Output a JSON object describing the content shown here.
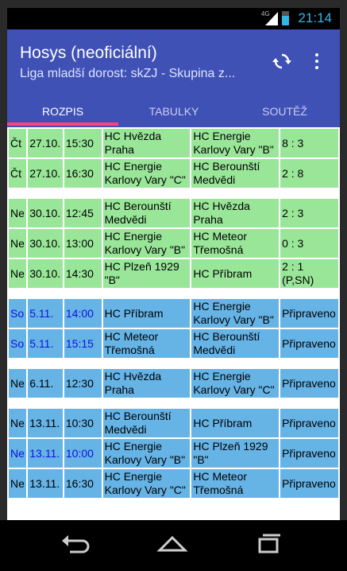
{
  "status_bar": {
    "time": "21:14",
    "network": "4G"
  },
  "app_bar": {
    "title": "Hosys (neoficiální)",
    "subtitle": "Liga mladší dorost: skZJ - Skupina z..."
  },
  "tabs": [
    {
      "label": "ROZPIS",
      "active": true
    },
    {
      "label": "TABULKY",
      "active": false
    },
    {
      "label": "SOUTĚŽ",
      "active": false
    }
  ],
  "colors": {
    "app_bar": "#3f51b5",
    "tab_indicator": "#ff4081",
    "played_row": "#99e699",
    "upcoming_row": "#66b3e6",
    "weekend_text": "#1010e0"
  },
  "schedule": {
    "groups": [
      {
        "color": "green",
        "rows": [
          {
            "day": "Čt",
            "date": "27.10.",
            "time": "15:30",
            "home": "HC Hvězda Praha",
            "away": "HC Energie Karlovy Vary \"B\"",
            "result": "8 : 3",
            "highlight": false
          },
          {
            "day": "Čt",
            "date": "27.10.",
            "time": "16:30",
            "home": "HC Energie Karlovy Vary \"C\"",
            "away": "HC Berounští Medvědi",
            "result": "2 : 8",
            "highlight": false
          }
        ]
      },
      {
        "color": "green",
        "rows": [
          {
            "day": "Ne",
            "date": "30.10.",
            "time": "12:45",
            "home": "HC Berounští Medvědi",
            "away": "HC Hvězda Praha",
            "result": "2 : 3",
            "highlight": false
          },
          {
            "day": "Ne",
            "date": "30.10.",
            "time": "13:00",
            "home": "HC Energie Karlovy Vary \"B\"",
            "away": "HC Meteor Třemošná",
            "result": "0 : 3",
            "highlight": false
          },
          {
            "day": "Ne",
            "date": "30.10.",
            "time": "14:30",
            "home": "HC Plzeň 1929 \"B\"",
            "away": "HC Příbram",
            "result": "2 : 1 (P,SN)",
            "highlight": false
          }
        ]
      },
      {
        "color": "blue",
        "rows": [
          {
            "day": "So",
            "date": "5.11.",
            "time": "14:00",
            "home": "HC Příbram",
            "away": "HC Energie Karlovy Vary \"B\"",
            "result": "Připraveno",
            "highlight": true
          },
          {
            "day": "So",
            "date": "5.11.",
            "time": "15:15",
            "home": "HC Meteor Třemošná",
            "away": "HC Berounští Medvědi",
            "result": "Připraveno",
            "highlight": true
          }
        ]
      },
      {
        "color": "blue",
        "rows": [
          {
            "day": "Ne",
            "date": "6.11.",
            "time": "12:30",
            "home": "HC Hvězda Praha",
            "away": "HC Energie Karlovy Vary \"C\"",
            "result": "Připraveno",
            "highlight": false
          }
        ]
      },
      {
        "color": "blue",
        "rows": [
          {
            "day": "Ne",
            "date": "13.11.",
            "time": "10:30",
            "home": "HC Berounští Medvědi",
            "away": "HC Příbram",
            "result": "Připraveno",
            "highlight": false
          },
          {
            "day": "Ne",
            "date": "13.11.",
            "time": "10:00",
            "home": "HC Energie Karlovy Vary \"B\"",
            "away": "HC Plzeň 1929 \"B\"",
            "result": "Připraveno",
            "highlight": true
          },
          {
            "day": "Ne",
            "date": "13.11.",
            "time": "16:30",
            "home": "HC Energie Karlovy Vary \"C\"",
            "away": "HC Meteor Třemošná",
            "result": "Připraveno",
            "highlight": false
          }
        ]
      }
    ]
  }
}
